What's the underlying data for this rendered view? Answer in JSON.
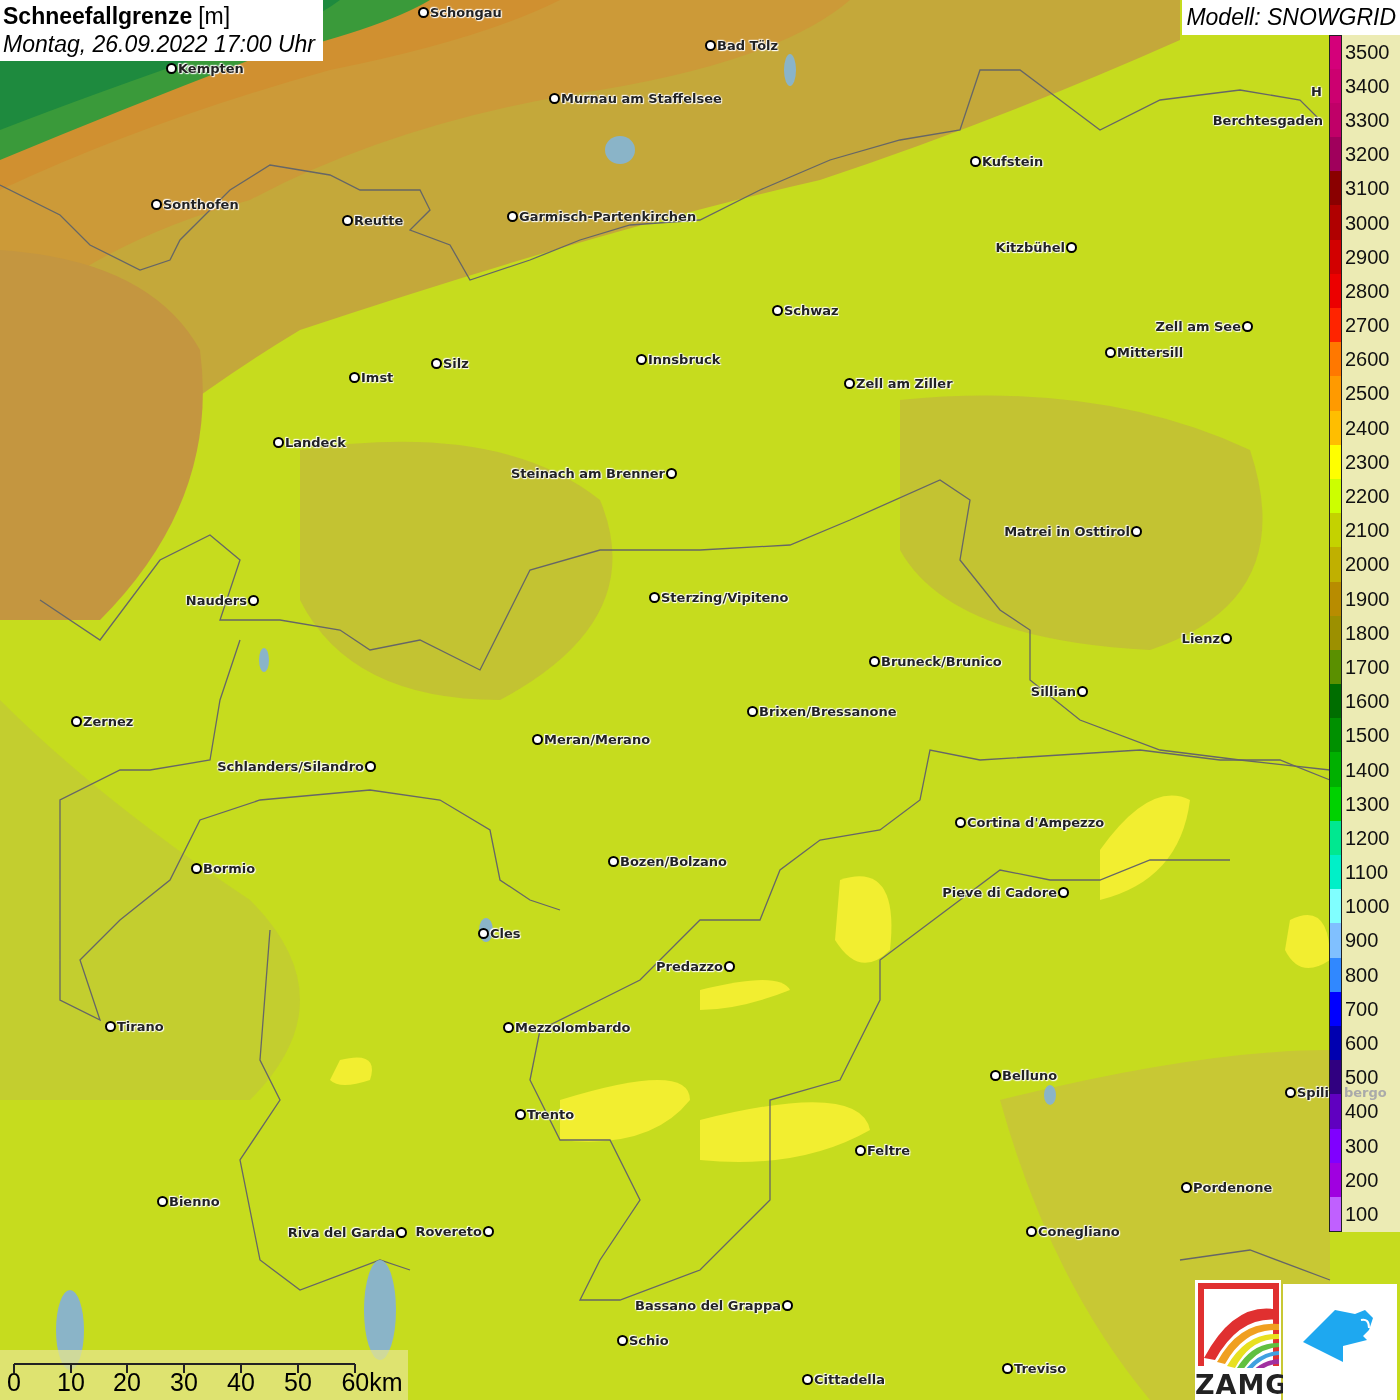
{
  "title": {
    "name": "Schneefallgrenze",
    "unit": "[m]",
    "time": "Montag, 26.09.2022 17:00 Uhr"
  },
  "model": "Modell: SNOWGRID",
  "towns": [
    {
      "name": "Schongau",
      "kind": "town"
    },
    {
      "name": "Bad Tölz",
      "kind": "town"
    },
    {
      "name": "Kempten",
      "kind": "town"
    },
    {
      "name": "Murnau am Staffelsee",
      "kind": "town"
    },
    {
      "name": "Sonthofen",
      "kind": "town"
    },
    {
      "name": "Reutte",
      "kind": "town"
    },
    {
      "name": "Garmisch-Partenkirchen",
      "kind": "town"
    },
    {
      "name": "Kufstein",
      "kind": "town"
    },
    {
      "name": "Berchtesgaden",
      "kind": "label"
    },
    {
      "name": "Kitzbühel",
      "kind": "town"
    },
    {
      "name": "Schwaz",
      "kind": "town"
    },
    {
      "name": "Zell am See",
      "kind": "town"
    },
    {
      "name": "Innsbruck",
      "kind": "town"
    },
    {
      "name": "Silz",
      "kind": "town"
    },
    {
      "name": "Imst",
      "kind": "town"
    },
    {
      "name": "Mittersill",
      "kind": "town"
    },
    {
      "name": "Zell am Ziller",
      "kind": "town"
    },
    {
      "name": "Landeck",
      "kind": "town"
    },
    {
      "name": "Steinach am Brenner",
      "kind": "town"
    },
    {
      "name": "Matrei in Osttirol",
      "kind": "town"
    },
    {
      "name": "Nauders",
      "kind": "town"
    },
    {
      "name": "Sterzing/Vipiteno",
      "kind": "town"
    },
    {
      "name": "Lienz",
      "kind": "town"
    },
    {
      "name": "Bruneck/Brunico",
      "kind": "town"
    },
    {
      "name": "Sillian",
      "kind": "town"
    },
    {
      "name": "Brixen/Bressanone",
      "kind": "town"
    },
    {
      "name": "Zernez",
      "kind": "town"
    },
    {
      "name": "Meran/Merano",
      "kind": "town"
    },
    {
      "name": "Schlanders/Silandro",
      "kind": "town"
    },
    {
      "name": "Cortina d'Ampezzo",
      "kind": "town"
    },
    {
      "name": "Bozen/Bolzano",
      "kind": "town"
    },
    {
      "name": "Bormio",
      "kind": "town"
    },
    {
      "name": "Pieve di Cadore",
      "kind": "town"
    },
    {
      "name": "Cles",
      "kind": "town"
    },
    {
      "name": "Predazzo",
      "kind": "town"
    },
    {
      "name": "Tirano",
      "kind": "town"
    },
    {
      "name": "Mezzolombardo",
      "kind": "town"
    },
    {
      "name": "Belluno",
      "kind": "town"
    },
    {
      "name": "Spili",
      "kind": "town"
    },
    {
      "name": "Trento",
      "kind": "town"
    },
    {
      "name": "Feltre",
      "kind": "town"
    },
    {
      "name": "Pordenone",
      "kind": "town"
    },
    {
      "name": "Bienno",
      "kind": "town"
    },
    {
      "name": "Riva del Garda",
      "kind": "town"
    },
    {
      "name": "Rovereto",
      "kind": "town"
    },
    {
      "name": "Conegliano",
      "kind": "town"
    },
    {
      "name": "Bassano del Grappa",
      "kind": "town"
    },
    {
      "name": "Schio",
      "kind": "town"
    },
    {
      "name": "Treviso",
      "kind": "town"
    },
    {
      "name": "Cittadella",
      "kind": "town"
    },
    {
      "name": "H",
      "kind": "label"
    },
    {
      "name": "bergo",
      "kind": "faded"
    }
  ],
  "legend": [
    {
      "label": "3500",
      "color": "#d4007a"
    },
    {
      "label": "3400",
      "color": "#cc0070"
    },
    {
      "label": "3300",
      "color": "#c00068"
    },
    {
      "label": "3200",
      "color": "#a0005c"
    },
    {
      "label": "3100",
      "color": "#8a0000"
    },
    {
      "label": "3000",
      "color": "#b00000"
    },
    {
      "label": "2900",
      "color": "#d20000"
    },
    {
      "label": "2800",
      "color": "#ec0000"
    },
    {
      "label": "2700",
      "color": "#ff2400"
    },
    {
      "label": "2600",
      "color": "#ff7800"
    },
    {
      "label": "2500",
      "color": "#ff9a00"
    },
    {
      "label": "2400",
      "color": "#ffbe00"
    },
    {
      "label": "2300",
      "color": "#ffff00"
    },
    {
      "label": "2200",
      "color": "#ccff00"
    },
    {
      "label": "2100",
      "color": "#c4d200"
    },
    {
      "label": "2000",
      "color": "#c0b000"
    },
    {
      "label": "1900",
      "color": "#b88c00"
    },
    {
      "label": "1800",
      "color": "#9c9000"
    },
    {
      "label": "1700",
      "color": "#5a9000"
    },
    {
      "label": "1600",
      "color": "#006e00"
    },
    {
      "label": "1500",
      "color": "#009000"
    },
    {
      "label": "1400",
      "color": "#00b000"
    },
    {
      "label": "1300",
      "color": "#00d200"
    },
    {
      "label": "1200",
      "color": "#00e890"
    },
    {
      "label": "1100",
      "color": "#00f0c8"
    },
    {
      "label": "1000",
      "color": "#80ffff"
    },
    {
      "label": "900",
      "color": "#80c0ff"
    },
    {
      "label": "800",
      "color": "#3088ff"
    },
    {
      "label": "700",
      "color": "#0000ff"
    },
    {
      "label": "600",
      "color": "#0000b0"
    },
    {
      "label": "500",
      "color": "#300080"
    },
    {
      "label": "400",
      "color": "#6000c0"
    },
    {
      "label": "300",
      "color": "#8000ff"
    },
    {
      "label": "200",
      "color": "#a000e0"
    },
    {
      "label": "100",
      "color": "#c060ff"
    }
  ],
  "scale_bar": [
    "0",
    "10",
    "20",
    "30",
    "40",
    "50",
    "60km"
  ],
  "logos": {
    "left": "ZAMG"
  }
}
